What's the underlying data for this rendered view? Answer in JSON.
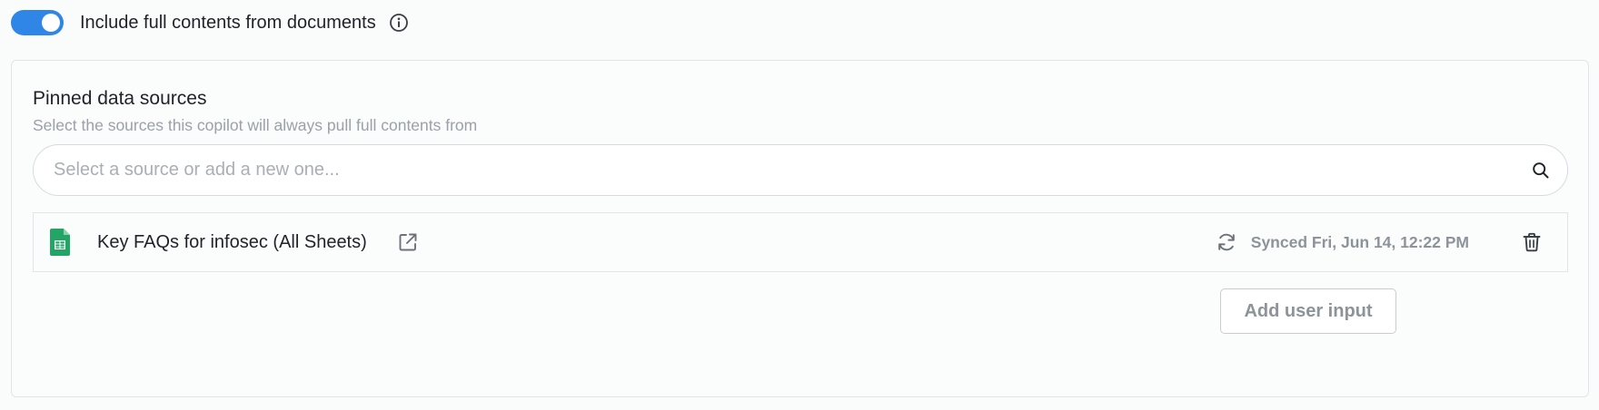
{
  "toggle": {
    "label": "Include full contents from documents",
    "checked": true,
    "accent_color": "#2f86e6",
    "info_icon": "info-icon"
  },
  "pinned": {
    "title": "Pinned data sources",
    "subtitle": "Select the sources this copilot will always pull full contents from",
    "search": {
      "placeholder": "Select a source or add a new one...",
      "value": "",
      "icon": "search-icon"
    },
    "sources": [
      {
        "icon": "google-sheets-icon",
        "name": "Key FAQs for infosec (All Sheets)",
        "link_icon": "external-link-icon",
        "sync_icon": "refresh-icon",
        "sync_status": "Synced Fri, Jun 14, 12:22 PM",
        "delete_icon": "trash-icon"
      }
    ],
    "add_button_label": "Add user input"
  }
}
